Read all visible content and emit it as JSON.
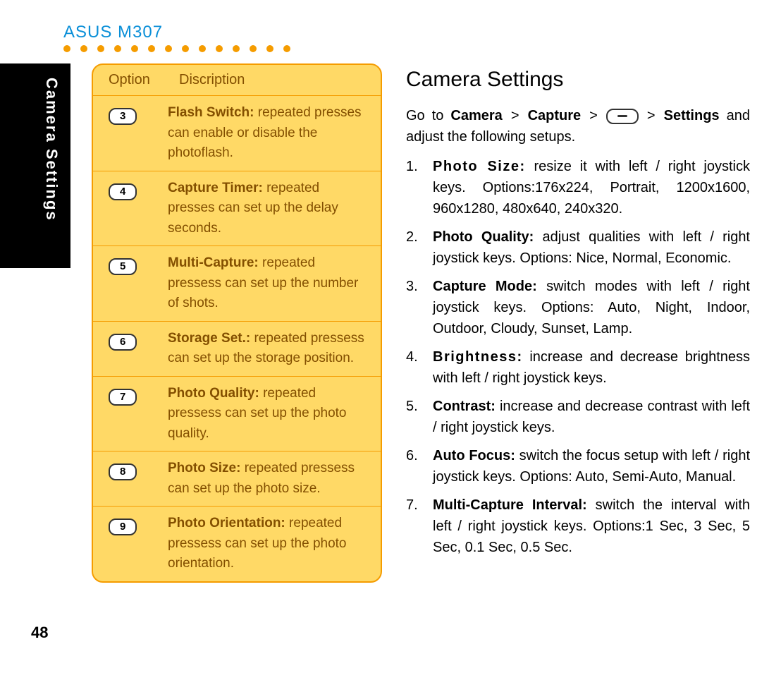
{
  "header": {
    "title": "ASUS M307"
  },
  "sidebar": {
    "label": "Camera Settings"
  },
  "page_number": "48",
  "section": {
    "title": "Camera Settings",
    "intro_prefix": "Go to ",
    "intro_camera": "Camera",
    "intro_capture": "Capture",
    "intro_settings": "Settings",
    "intro_suffix": " and adjust the following setups.",
    "gt": ">"
  },
  "table": {
    "head_option": "Option",
    "head_desc": "Discription",
    "rows": [
      {
        "key": "3",
        "title": "Flash Switch:",
        "desc": " repeated presses can enable or disable the photoflash."
      },
      {
        "key": "4",
        "title": "Capture Timer: ",
        "desc": " repeated presses can set up the delay seconds."
      },
      {
        "key": "5",
        "title": "Multi-Capture:",
        "desc": " repeated pressess can set up the number of shots."
      },
      {
        "key": "6",
        "title": "Storage Set.:",
        "desc": " repeated pressess can set up the storage position."
      },
      {
        "key": "7",
        "title": "Photo Quality:",
        "desc": " repeated pressess can set up the photo quality."
      },
      {
        "key": "8",
        "title": "Photo Size: ",
        "desc": " repeated pressess can set up the photo size."
      },
      {
        "key": "9",
        "title": "Photo Orientation:",
        "desc": " repeated pressess can set up the photo orientation."
      }
    ]
  },
  "list": [
    {
      "n": "1.",
      "title": "Photo Size:",
      "body": " resize it with left / right joystick keys. Options:176x224, Portrait, 1200x1600, 960x1280, 480x640, 240x320.",
      "spaced": true
    },
    {
      "n": "2.",
      "title": "Photo Quality:",
      "body": " adjust qualities with left / right joystick keys. Options: Nice, Normal, Economic.",
      "spaced": false
    },
    {
      "n": "3.",
      "title": "Capture Mode:",
      "body": " switch modes with left / right joystick keys. Options: Auto, Night, Indoor, Outdoor, Cloudy, Sunset, Lamp.",
      "spaced": false
    },
    {
      "n": "4.",
      "title": "Brightness:",
      "body": " increase and decrease brightness with left / right joystick keys.",
      "spaced": true
    },
    {
      "n": "5.",
      "title": "Contrast:",
      "body": " increase and decrease contrast with left / right joystick keys.",
      "spaced": false
    },
    {
      "n": "6.",
      "title": "Auto Focus:",
      "body": " switch the focus setup with left / right joystick keys. Options: Auto, Semi-Auto, Manual.",
      "spaced": false
    },
    {
      "n": "7.",
      "title": "Multi-Capture Interval:",
      "body": " switch the interval with left / right joystick keys. Options:1 Sec, 3 Sec, 5 Sec, 0.1 Sec, 0.5 Sec.",
      "spaced": false
    }
  ]
}
